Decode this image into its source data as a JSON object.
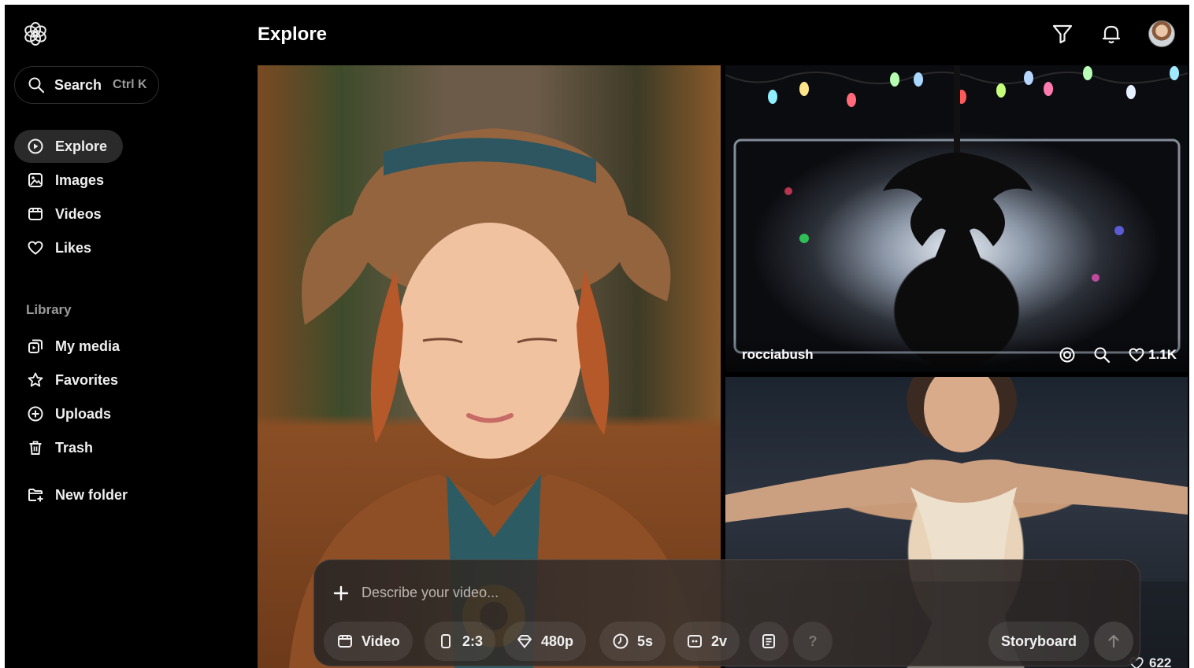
{
  "header": {
    "title": "Explore"
  },
  "search": {
    "label": "Search",
    "shortcut": "Ctrl K"
  },
  "nav": [
    {
      "label": "Explore",
      "icon": "explore-icon"
    },
    {
      "label": "Images",
      "icon": "image-icon"
    },
    {
      "label": "Videos",
      "icon": "video-icon"
    },
    {
      "label": "Likes",
      "icon": "heart-icon"
    }
  ],
  "library": {
    "heading": "Library",
    "items": [
      {
        "label": "My media",
        "icon": "media-icon"
      },
      {
        "label": "Favorites",
        "icon": "star-icon"
      },
      {
        "label": "Uploads",
        "icon": "upload-icon"
      },
      {
        "label": "Trash",
        "icon": "trash-icon"
      }
    ]
  },
  "new_folder": {
    "label": "New folder"
  },
  "feed": {
    "top_right": {
      "username": "rocciabush",
      "likes": "1.1K"
    },
    "bottom_right": {
      "likes": "622"
    }
  },
  "composer": {
    "placeholder": "Describe your video...",
    "type_label": "Video",
    "aspect_label": "2:3",
    "quality_label": "480p",
    "duration_label": "5s",
    "variations_label": "2v",
    "help_label": "?",
    "storyboard_label": "Storyboard"
  }
}
